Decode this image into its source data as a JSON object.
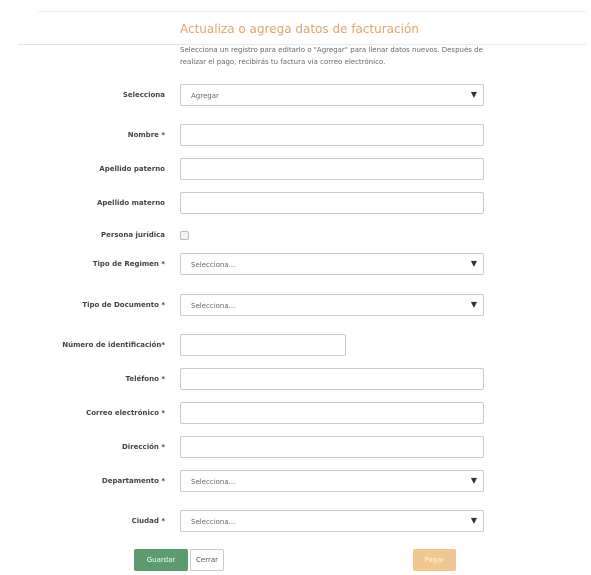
{
  "header": {
    "title": "Actualiza o agrega datos de facturación",
    "description": "Selecciona un registro para editarlo o \"Agregar\" para llenar datos nuevos. Después de realizar el pago, recibirás tu factura vía correo electrónico."
  },
  "form": {
    "selecciona": {
      "label": "Selecciona",
      "value": "Agregar"
    },
    "nombre": {
      "label": "Nombre *",
      "value": ""
    },
    "apellido_paterno": {
      "label": "Apellido paterno",
      "value": ""
    },
    "apellido_materno": {
      "label": "Apellido materno",
      "value": ""
    },
    "persona_juridica": {
      "label": "Persona jurídica",
      "checked": false
    },
    "tipo_regimen": {
      "label": "Tipo de Regimen *",
      "value": "Selecciona..."
    },
    "tipo_documento": {
      "label": "Tipo de Documento *",
      "value": "Selecciona..."
    },
    "numero_identificacion": {
      "label": "Número de identificación*",
      "value": ""
    },
    "telefono": {
      "label": "Teléfono *",
      "value": ""
    },
    "correo": {
      "label": "Correo electrónico *",
      "value": ""
    },
    "direccion": {
      "label": "Dirección *",
      "value": ""
    },
    "departamento": {
      "label": "Departamento *",
      "value": "Selecciona..."
    },
    "ciudad": {
      "label": "Ciudad *",
      "value": "Selecciona..."
    }
  },
  "buttons": {
    "guardar": "Guardar",
    "cerrar": "Cerrar",
    "pagar": "Pagar"
  },
  "icons": {
    "dropdown": "chevron-down-icon"
  },
  "colors": {
    "title": "#e0a36c",
    "guardar": "#5c9b6e",
    "pagar": "#f2c78f"
  }
}
